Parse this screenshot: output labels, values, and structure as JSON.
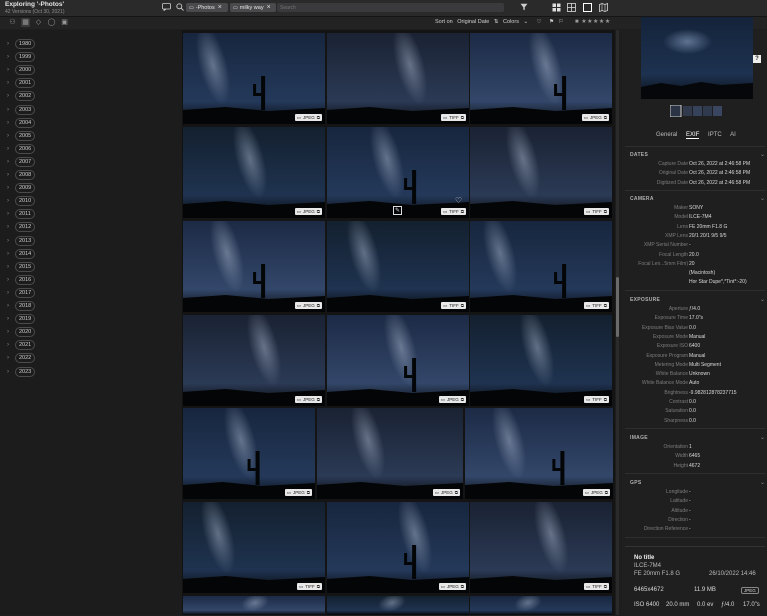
{
  "window": {
    "title": "Exploring '-Photos'",
    "subtitle": "42 Versions (Oct 30, 2021)"
  },
  "filters": {
    "chip1": "-Photos",
    "chip2": "milky way",
    "search_placeholder": "Search"
  },
  "sort": {
    "sort_on": "Sort on",
    "field": "Original Date",
    "colors": "Colors"
  },
  "years": [
    "1980",
    "1999",
    "2000",
    "2001",
    "2002",
    "2003",
    "2004",
    "2005",
    "2006",
    "2007",
    "2008",
    "2009",
    "2010",
    "2011",
    "2012",
    "2013",
    "2014",
    "2015",
    "2016",
    "2017",
    "2018",
    "2019",
    "2020",
    "2021",
    "2022",
    "2023"
  ],
  "grid_badges": [
    "JPEG",
    "TIFF",
    "JPEG",
    "JPEG",
    "TIFF",
    "TIFF",
    "JPEG",
    "TIFF",
    "TIFF",
    "JPEG",
    "JPEG",
    "TIFF",
    "JPEG",
    "JPEG",
    "JPEG",
    "TIFF",
    "JPEG",
    "TIFF"
  ],
  "panel": {
    "tabs": [
      "General",
      "EXIF",
      "IPTC",
      "AI"
    ],
    "dates_title": "DATES",
    "dates": [
      {
        "k": "Capture Date",
        "v": "Oct 26, 2022 at 2:46:58 PM"
      },
      {
        "k": "Original Date",
        "v": "Oct 26, 2022 at 2:46:58 PM"
      },
      {
        "k": "Digitized Date",
        "v": "Oct 26, 2022 at 2:46:58 PM"
      }
    ],
    "camera_title": "CAMERA",
    "camera": [
      {
        "k": "Maker",
        "v": "SONY"
      },
      {
        "k": "Model",
        "v": "ILCE-7M4"
      },
      {
        "k": "Lens",
        "v": "FE 20mm F1.8 G"
      },
      {
        "k": "XMP Lens",
        "v": "20/1 20/1 9/5 9/5"
      },
      {
        "k": "XMP Serial Number",
        "v": "-"
      },
      {
        "k": "Focal Length",
        "v": "20.0"
      },
      {
        "k": "Focal Len...5mm Film)",
        "v": "20"
      },
      {
        "k": "",
        "v": "(Macintosh)"
      },
      {
        "k": "",
        "v": "Hor Star Dupe*,*Tint*:-20)"
      }
    ],
    "exposure_title": "EXPOSURE",
    "exposure": [
      {
        "k": "Aperture",
        "v": "ƒ/4.0"
      },
      {
        "k": "Exposure Time",
        "v": "17.0\"s"
      },
      {
        "k": "Exposure Bias Value",
        "v": "0.0"
      },
      {
        "k": "Exposure Mode",
        "v": "Manual"
      },
      {
        "k": "Exposure ISO",
        "v": "6400"
      },
      {
        "k": "Exposure Program",
        "v": "Manual"
      },
      {
        "k": "Metering Mode",
        "v": "Multi Segment"
      },
      {
        "k": "White Balance",
        "v": "Unknown"
      },
      {
        "k": "White Balance Mode",
        "v": "Auto"
      },
      {
        "k": "Brightness",
        "v": "-9.982812878237715"
      },
      {
        "k": "Contrast",
        "v": "0.0"
      },
      {
        "k": "Saturation",
        "v": "0.0"
      },
      {
        "k": "Sharpness",
        "v": "0.0"
      }
    ],
    "image_title": "IMAGE",
    "image": [
      {
        "k": "Orientation",
        "v": "1"
      },
      {
        "k": "Width",
        "v": "6465"
      },
      {
        "k": "Height",
        "v": "4672"
      }
    ],
    "gps_title": "GPS",
    "gps": [
      {
        "k": "Longitude",
        "v": "-"
      },
      {
        "k": "Latitude",
        "v": "-"
      },
      {
        "k": "Altitude",
        "v": "-"
      },
      {
        "k": "Direction",
        "v": "-"
      },
      {
        "k": "Direction Reference",
        "v": "-"
      }
    ]
  },
  "info": {
    "title": "No title",
    "model": "ILCE-7M4",
    "lens": "FE 20mm F1.8 G",
    "date": "26/10/2022 14:46",
    "dims": "6465x4672",
    "size": "11.9 MB",
    "format": "JPEG",
    "iso": "ISO 6400",
    "focal": "20.0 mm",
    "ev": "0.0 ev",
    "aperture": "ƒ/4.0",
    "shutter": "17.0\"s"
  }
}
